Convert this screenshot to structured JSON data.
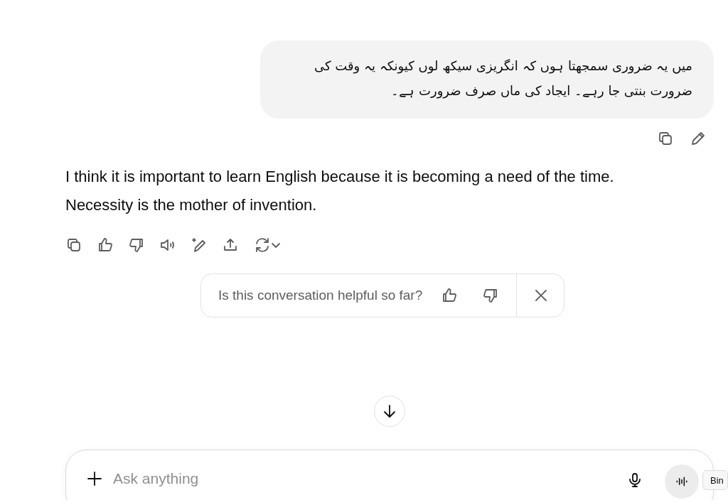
{
  "user_message": {
    "text": "میں یہ ضروری سمجھتا ہوں کہ انگریزی سیکھ لوں کیونکہ یہ وقت کی ضرورت بنتی جا رہے۔ ایجاد کی ماں صرف ضرورت ہے۔"
  },
  "assistant_message": {
    "text": "I think it is important to learn English because it is becoming a need of the time. Necessity is the mother of invention."
  },
  "feedback": {
    "question": "Is this conversation helpful so far?"
  },
  "composer": {
    "placeholder": "Ask anything"
  },
  "tooltip": {
    "text": "Bin"
  }
}
